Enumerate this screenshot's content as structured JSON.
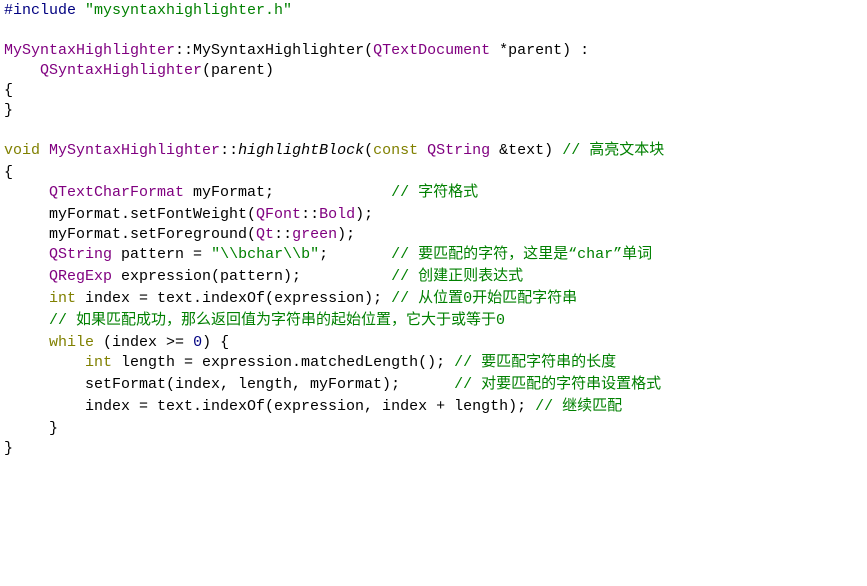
{
  "colors": {
    "preprocessor": "#000080",
    "string": "#008000",
    "class": "#800080",
    "keyword": "#808000",
    "comment": "#008000",
    "number": "#000080",
    "default": "#000000"
  },
  "lines": [
    {
      "tokens": [
        [
          "preprocessor",
          "#include "
        ],
        [
          "string",
          "\"mysyntaxhighlighter.h\""
        ]
      ]
    },
    {
      "tokens": []
    },
    {
      "tokens": [
        [
          "class",
          "MySyntaxHighlighter"
        ],
        [
          "default",
          "::"
        ],
        [
          "default",
          "MySyntaxHighlighter"
        ],
        [
          "default",
          "("
        ],
        [
          "class",
          "QTextDocument"
        ],
        [
          "default",
          " *parent) :"
        ]
      ]
    },
    {
      "tokens": [
        [
          "default",
          "    "
        ],
        [
          "class",
          "QSyntaxHighlighter"
        ],
        [
          "default",
          "(parent)"
        ]
      ]
    },
    {
      "tokens": [
        [
          "default",
          "{"
        ]
      ]
    },
    {
      "tokens": [
        [
          "default",
          "}"
        ]
      ]
    },
    {
      "tokens": []
    },
    {
      "tokens": [
        [
          "keyword",
          "void"
        ],
        [
          "default",
          " "
        ],
        [
          "class",
          "MySyntaxHighlighter"
        ],
        [
          "default",
          "::"
        ],
        [
          "italic",
          "highlightBlock"
        ],
        [
          "default",
          "("
        ],
        [
          "keyword",
          "const"
        ],
        [
          "default",
          " "
        ],
        [
          "class",
          "QString"
        ],
        [
          "default",
          " &text) "
        ],
        [
          "comment",
          "// 高亮文本块"
        ]
      ]
    },
    {
      "tokens": [
        [
          "default",
          "{"
        ]
      ]
    },
    {
      "tokens": [
        [
          "default",
          "     "
        ],
        [
          "class",
          "QTextCharFormat"
        ],
        [
          "default",
          " myFormat;             "
        ],
        [
          "comment",
          "// 字符格式"
        ]
      ]
    },
    {
      "tokens": [
        [
          "default",
          "     myFormat.setFontWeight("
        ],
        [
          "class",
          "QFont"
        ],
        [
          "default",
          "::"
        ],
        [
          "class",
          "Bold"
        ],
        [
          "default",
          ");"
        ]
      ]
    },
    {
      "tokens": [
        [
          "default",
          "     myFormat.setForeground("
        ],
        [
          "class",
          "Qt"
        ],
        [
          "default",
          "::"
        ],
        [
          "class",
          "green"
        ],
        [
          "default",
          ");"
        ]
      ]
    },
    {
      "tokens": [
        [
          "default",
          "     "
        ],
        [
          "class",
          "QString"
        ],
        [
          "default",
          " pattern = "
        ],
        [
          "string",
          "\"\\\\bchar\\\\b\""
        ],
        [
          "default",
          ";       "
        ],
        [
          "comment",
          "// 要匹配的字符，这里是“char”单词"
        ]
      ]
    },
    {
      "tokens": [
        [
          "default",
          "     "
        ],
        [
          "class",
          "QRegExp"
        ],
        [
          "default",
          " expression(pattern);          "
        ],
        [
          "comment",
          "// 创建正则表达式"
        ]
      ]
    },
    {
      "tokens": [
        [
          "default",
          "     "
        ],
        [
          "keyword",
          "int"
        ],
        [
          "default",
          " index = text.indexOf(expression); "
        ],
        [
          "comment",
          "// 从位置0开始匹配字符串"
        ]
      ]
    },
    {
      "tokens": [
        [
          "default",
          "     "
        ],
        [
          "comment",
          "// 如果匹配成功，那么返回值为字符串的起始位置，它大于或等于0"
        ]
      ]
    },
    {
      "tokens": [
        [
          "default",
          "     "
        ],
        [
          "keyword",
          "while"
        ],
        [
          "default",
          " (index >= "
        ],
        [
          "number",
          "0"
        ],
        [
          "default",
          ") {"
        ]
      ]
    },
    {
      "tokens": [
        [
          "default",
          "         "
        ],
        [
          "keyword",
          "int"
        ],
        [
          "default",
          " length = expression.matchedLength(); "
        ],
        [
          "comment",
          "// 要匹配字符串的长度"
        ]
      ]
    },
    {
      "tokens": [
        [
          "default",
          "         setFormat(index, length, myFormat);      "
        ],
        [
          "comment",
          "// 对要匹配的字符串设置格式"
        ]
      ]
    },
    {
      "tokens": [
        [
          "default",
          "         index = text.indexOf(expression, index + length); "
        ],
        [
          "comment",
          "// 继续匹配"
        ]
      ]
    },
    {
      "tokens": [
        [
          "default",
          "     }"
        ]
      ]
    },
    {
      "tokens": [
        [
          "default",
          "}"
        ]
      ]
    }
  ]
}
